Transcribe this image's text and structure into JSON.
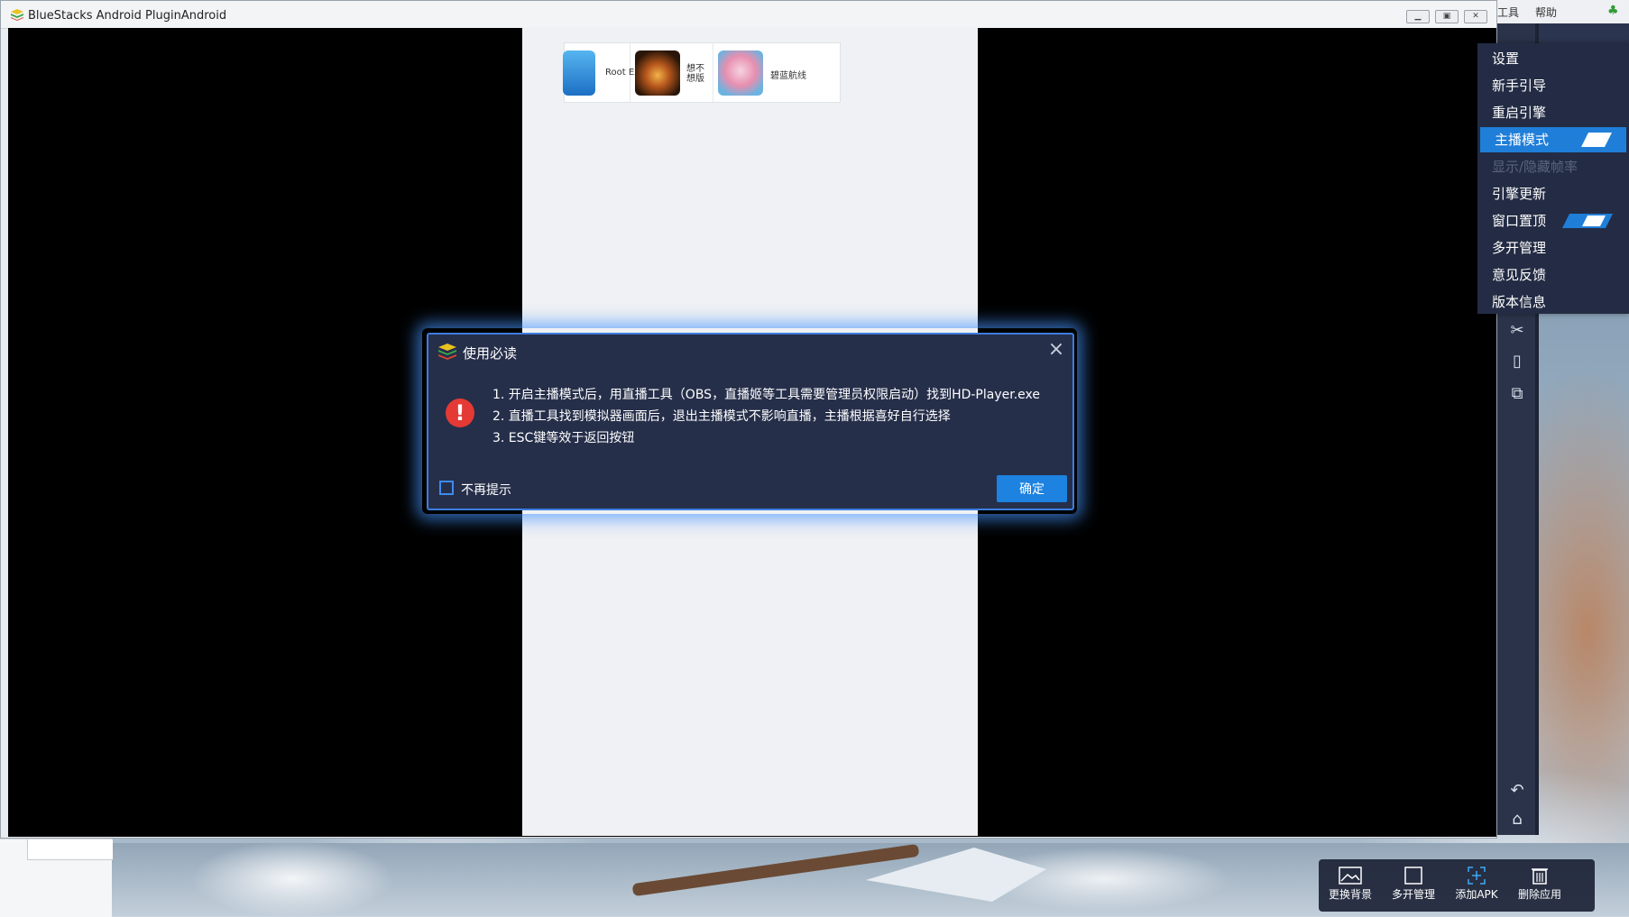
{
  "window": {
    "title": "BlueStacks Android PluginAndroid",
    "buttons": [
      "minimize",
      "restore",
      "close"
    ]
  },
  "header_menu": {
    "items": [
      "工具",
      "帮助"
    ]
  },
  "apps": [
    {
      "name": "Root Ex",
      "icon": "root-explorer-icon"
    },
    {
      "name": "想不想版",
      "icon": "meditating-figure-icon"
    },
    {
      "name": "碧蓝航线",
      "icon": "anime-girl-icon"
    }
  ],
  "menu": {
    "items": [
      {
        "label": "设置"
      },
      {
        "label": "新手引导"
      },
      {
        "label": "重启引擎"
      },
      {
        "label": "主播模式",
        "active": true,
        "toggle": "on"
      },
      {
        "label": "显示/隐藏帧率",
        "disabled": true
      },
      {
        "label": "引擎更新"
      },
      {
        "label": "窗口置顶",
        "toggle": "on"
      },
      {
        "label": "多开管理"
      },
      {
        "label": "意见反馈"
      },
      {
        "label": "版本信息"
      }
    ]
  },
  "dialog": {
    "title": "使用必读",
    "lines": [
      "1. 开启主播模式后，用直播工具（OBS，直播姬等工具需要管理员权限启动）找到HD-Player.exe",
      "2. 直播工具找到模拟器画面后，退出主播模式不影响直播，主播根据喜好自行选择",
      "3. ESC键等效于返回按钮"
    ],
    "checkbox_label": "不再提示",
    "ok_label": "确定"
  },
  "bottom_toolbar": [
    {
      "label": "更换背景",
      "icon": "image-icon"
    },
    {
      "label": "多开管理",
      "icon": "window-icon"
    },
    {
      "label": "添加APK",
      "icon": "add-apk-icon"
    },
    {
      "label": "删除应用",
      "icon": "trash-icon"
    }
  ],
  "colors": {
    "dialog_bg": "#262f4a",
    "accent": "#1f7ed8",
    "menu_bg": "#232c44",
    "warning": "#e53935"
  }
}
